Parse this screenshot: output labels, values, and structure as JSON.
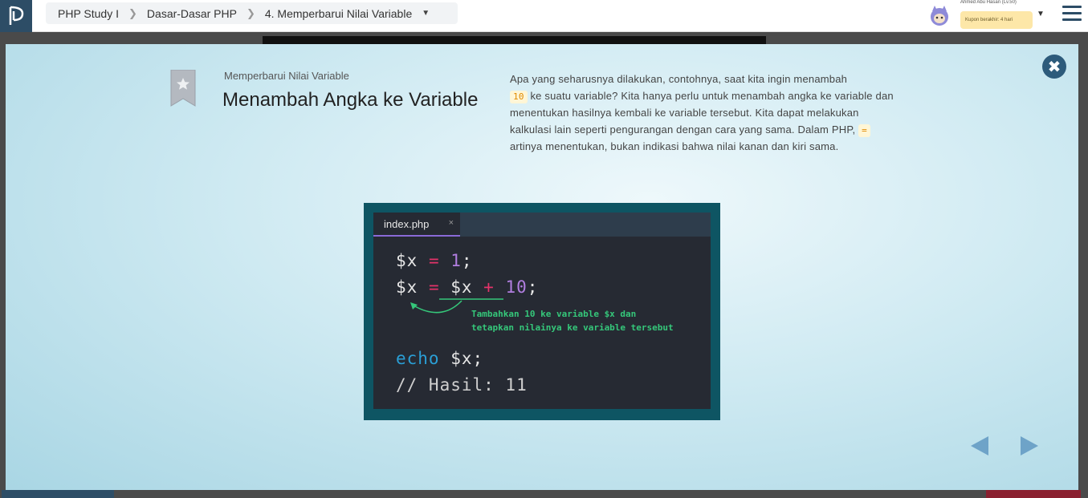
{
  "topbar": {
    "breadcrumbs": [
      "PHP Study I",
      "Dasar-Dasar PHP",
      "4. Memperbarui Nilai Variable"
    ],
    "user_name": "Ahmed Abu Hasan (Lv.50)",
    "coupon": "Kupon berakhir: 4 hari"
  },
  "modal": {
    "subtitle": "Memperbarui Nilai Variable",
    "title": "Menambah Angka ke Variable",
    "desc_1": "Apa yang seharusnya dilakukan, contohnya, saat kita ingin menambah",
    "chip_1": "10",
    "desc_2": " ke suatu variable? Kita hanya perlu untuk menambah angka ke variable dan menentukan hasilnya kembali ke variable tersebut. Kita dapat melakukan kalkulasi lain seperti pengurangan dengan cara yang sama. Dalam PHP, ",
    "chip_2": "=",
    "desc_3": " artinya menentukan, bukan indikasi bahwa nilai kanan dan kiri sama."
  },
  "figure": {
    "tab_name": "index.php",
    "tab_close": "×",
    "line1": {
      "var": "$x",
      "op": " = ",
      "num": "1",
      "end": ";"
    },
    "line2": {
      "var": "$x",
      "op": " = ",
      "var2": "$x",
      "op2": " + ",
      "num": "10",
      "end": ";"
    },
    "annotation_1": "Tambahkan 10 ke variable $x dan",
    "annotation_2": "tetapkan nilainya ke variable tersebut",
    "line3": {
      "kw": "echo",
      "rest": " $x;"
    },
    "line4": "// Hasil: 11"
  },
  "colors": {
    "brand": "#2d4d66",
    "accent_green": "#35c77a",
    "figure_border": "#0e5563"
  },
  "icons": [
    "logo-icon",
    "chevron-right-icon",
    "caret-down-icon",
    "avatar-icon",
    "hamburger-menu-icon",
    "close-icon",
    "bookmark-star-icon",
    "arrow-left-icon",
    "arrow-right-icon"
  ]
}
